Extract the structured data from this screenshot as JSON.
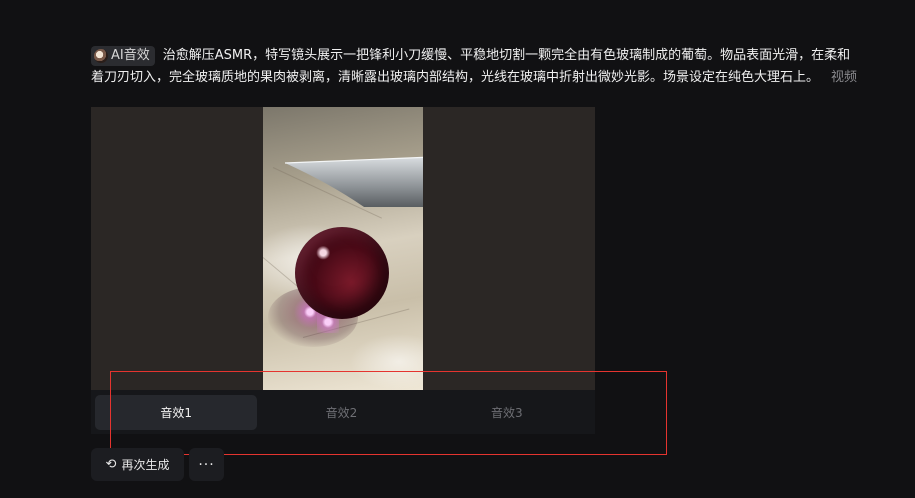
{
  "prompt": {
    "tag_label": "AI音效",
    "line1": "治愈解压ASMR，特写镜头展示一把锋利小刀缓慢、平稳地切割一颗完全由有色玻璃制成的葡萄。物品表面光滑，在柔和",
    "line2": "着刀刃切入，完全玻璃质地的果肉被剥离，清晰露出玻璃内部结构，光线在玻璃中折射出微妙光影。场景设定在纯色大理石上。",
    "more_label": "视频"
  },
  "sound_tabs": [
    {
      "label": "音效1",
      "active": true
    },
    {
      "label": "音效2",
      "active": false
    },
    {
      "label": "音效3",
      "active": false
    }
  ],
  "actions": {
    "regenerate_label": "再次生成",
    "more_label": "···"
  },
  "colors": {
    "background": "#111113",
    "tab_active": "#26282d",
    "highlight": "#e5342f"
  }
}
